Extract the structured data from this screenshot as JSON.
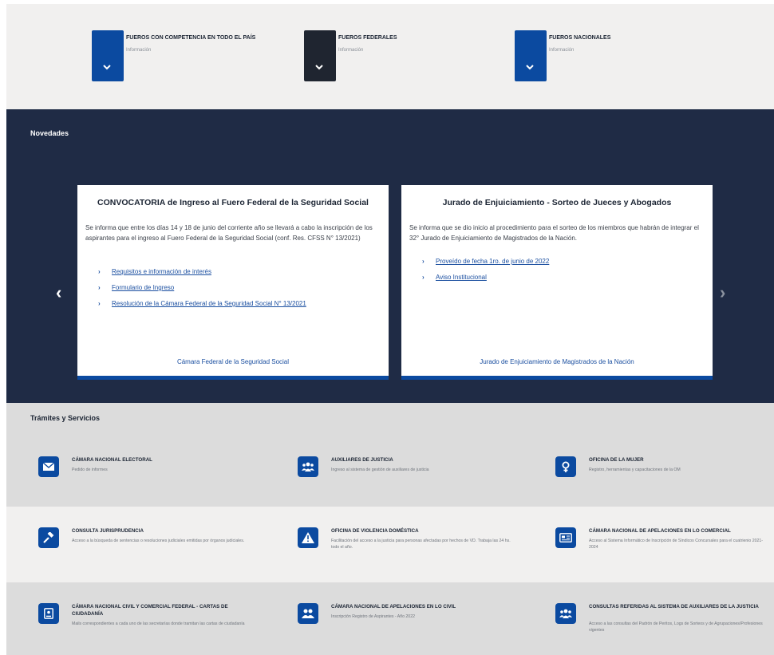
{
  "fueros": [
    {
      "title": "FUEROS CON COMPETENCIA EN TODO EL PAÍS",
      "subtitle": "Información",
      "color": "#0b4aa0",
      "icon": "chevron-down-icon"
    },
    {
      "title": "FUEROS FEDERALES",
      "subtitle": "Información",
      "color": "#1f2530",
      "icon": "chevron-down-icon"
    },
    {
      "title": "FUEROS NACIONALES",
      "subtitle": "Información",
      "color": "#0b4aa0",
      "icon": "chevron-down-icon"
    }
  ],
  "novedades": {
    "title": "Novedades",
    "cards": [
      {
        "title": "CONVOCATORIA de Ingreso al Fuero Federal de la Seguridad Social",
        "text": "Se informa que entre los días 14 y 18 de junio del corriente año se llevará a cabo la inscripción de los aspirantes para el ingreso al Fuero Federal de la Seguridad Social (conf. Res. CFSS N° 13/2021)",
        "links": [
          "Requisitos e información de interés",
          "Formulario de Ingreso",
          "Resolución de la Cámara Federal de la Seguridad Social N° 13/2021"
        ],
        "footer": "Cámara Federal de la Seguridad Social"
      },
      {
        "title": "Jurado de Enjuiciamiento - Sorteo de Jueces y Abogados",
        "text": "Se informa que se dio inicio al procedimiento para el sorteo de los miembros que habrán de integrar el 32° Jurado de Enjuiciamiento de Magistrados de la Nación.",
        "links": [
          "Proveído de fecha 1ro. de junio de 2022",
          "Aviso Institucional"
        ],
        "footer": "Jurado de Enjuiciamiento de Magistrados de la Nación"
      }
    ],
    "prev_icon": "‹",
    "next_icon": "›"
  },
  "tramites": {
    "title": "Trámites y Servicios",
    "items": [
      {
        "title": "CÁMARA NACIONAL ELECTORAL",
        "desc": "Pedido de informes",
        "icon": "envelope-icon"
      },
      {
        "title": "AUXILIARES DE JUSTICIA",
        "desc": "Ingreso al sistema de gestión de auxiliares de justicia",
        "icon": "users-icon"
      },
      {
        "title": "OFICINA DE LA MUJER",
        "desc": "Registro, herramientas y capacitaciones de la OM",
        "icon": "female-icon"
      },
      {
        "title": "CONSULTA JURISPRUDENCIA",
        "desc": "Acceso a la búsqueda de sentencias o resoluciones judiciales emitidas por órganos judiciales.",
        "icon": "gavel-icon"
      },
      {
        "title": "OFICINA DE VIOLENCIA DOMÉSTICA",
        "desc": "Facilitación del acceso a la justicia para personas afectadas por hechos de VD. Trabaja las 24 hs. todo el año.",
        "icon": "warning-icon"
      },
      {
        "title": "CÁMARA NACIONAL DE APELACIONES EN LO COMERCIAL",
        "desc": "Acceso al Sistema Informático de Inscripción de Síndicos Concursales para el cuatrienio 2021-2024",
        "icon": "id-card-icon"
      },
      {
        "title": "CÁMARA NACIONAL CIVIL Y COMERCIAL FEDERAL - CARTAS DE CIUDADANÍA",
        "desc": "Mails correspondientes a cada uno de las secretarías donde tramitan las cartas de ciudadanía",
        "icon": "id-badge-icon"
      },
      {
        "title": "CÁMARA NACIONAL DE APELACIONES EN LO CIVIL",
        "desc": "Inscripción Registro de Aspirantes - Año 2022",
        "icon": "user-group-icon"
      },
      {
        "title": "CONSULTAS REFERIDAS AL SISTEMA DE AUXILIARES DE LA JUSTICIA",
        "desc": "Acceso a las consultas del Padrón de Peritos, Logs de Sorteos y de Agrupaciones/Profesiones vigentes",
        "icon": "users-icon"
      }
    ]
  }
}
